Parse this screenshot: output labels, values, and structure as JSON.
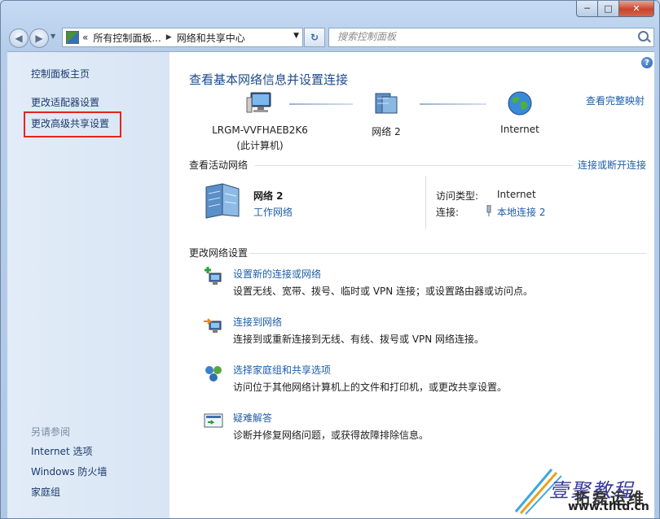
{
  "window": {
    "minimize_label": "─",
    "maximize_label": "□",
    "close_label": "✕"
  },
  "address_bar": {
    "segments": [
      "所有控制面板...",
      "网络和共享中心"
    ],
    "prefix": "«",
    "separator": "▶",
    "dropdown": "▼",
    "refresh_label": "↻"
  },
  "search": {
    "placeholder": "搜索控制面板"
  },
  "sidebar": {
    "items": [
      {
        "label": "控制面板主页"
      },
      {
        "label": "更改适配器设置"
      },
      {
        "label": "更改高级共享设置"
      }
    ],
    "see_also_title": "另请参阅",
    "see_also": [
      {
        "label": "Internet 选项"
      },
      {
        "label": "Windows 防火墙"
      },
      {
        "label": "家庭组"
      }
    ]
  },
  "main": {
    "help_label": "?",
    "title": "查看基本网络信息并设置连接",
    "view_full_map": "查看完整映射",
    "map": {
      "computer_name": "LRGM-VVFHAEB2K6",
      "computer_sub": "(此计算机)",
      "network_name": "网络  2",
      "internet": "Internet"
    },
    "active_networks": {
      "title": "查看活动网络",
      "connect_link": "连接或断开连接",
      "network_name": "网络  2",
      "network_type": "工作网络",
      "access_type_label": "访问类型:",
      "access_type_value": "Internet",
      "connections_label": "连接:",
      "connections_value": "本地连接 2"
    },
    "change_settings": {
      "title": "更改网络设置",
      "tasks": [
        {
          "title": "设置新的连接或网络",
          "desc": "设置无线、宽带、拨号、临时或 VPN 连接；或设置路由器或访问点。",
          "icon": "new-connection-icon"
        },
        {
          "title": "连接到网络",
          "desc": "连接到或重新连接到无线、有线、拨号或 VPN 网络连接。",
          "icon": "connect-network-icon"
        },
        {
          "title": "选择家庭组和共享选项",
          "desc": "访问位于其他网络计算机上的文件和打印机，或更改共享设置。",
          "icon": "homegroup-icon"
        },
        {
          "title": "疑难解答",
          "desc": "诊断并修复网络问题，或获得故障排除信息。",
          "icon": "troubleshoot-icon"
        }
      ]
    }
  },
  "watermark": {
    "line1": "壹聚教程",
    "line2": "拓磊运维",
    "url": "www.tlltd.cn"
  },
  "colors": {
    "link": "#1e5da8",
    "highlight_box": "#e12520",
    "title": "#1d4a8a"
  }
}
